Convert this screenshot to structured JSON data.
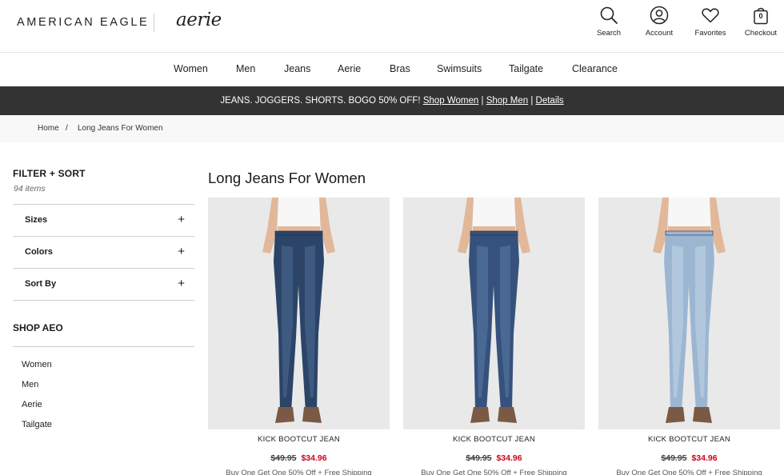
{
  "header": {
    "brand_primary": "AMERICAN EAGLE",
    "brand_secondary": "aerie",
    "utilities": {
      "search": "Search",
      "account": "Account",
      "favorites": "Favorites",
      "checkout": "Checkout",
      "bag_count": "0"
    }
  },
  "nav": {
    "categories": [
      "Women",
      "Men",
      "Jeans",
      "Aerie",
      "Bras",
      "Swimsuits",
      "Tailgate",
      "Clearance"
    ]
  },
  "promo": {
    "text": "JEANS. JOGGERS. SHORTS. BOGO 50% OFF!",
    "link_women": "Shop Women",
    "sep1": "|",
    "link_men": "Shop Men",
    "sep2": "|",
    "link_details": "Details"
  },
  "breadcrumb": {
    "home": "Home",
    "separator": "/",
    "current": "Long Jeans For Women"
  },
  "sidebar": {
    "filter_title": "FILTER + SORT",
    "item_count": "94 items",
    "facets": [
      {
        "label": "Sizes",
        "toggle": "+"
      },
      {
        "label": "Colors",
        "toggle": "+"
      },
      {
        "label": "Sort By",
        "toggle": "+"
      }
    ],
    "shop_title": "SHOP AEO",
    "shop_links": [
      "Women",
      "Men",
      "Aerie",
      "Tailgate"
    ]
  },
  "main": {
    "title": "Long Jeans For Women",
    "products": [
      {
        "name": "KICK BOOTCUT JEAN",
        "was": "$49.95",
        "now": "$34.96",
        "promo": "Buy One Get One 50% Off + Free Shipping",
        "wash": "#2b4468",
        "wash_light": "#4e6d96"
      },
      {
        "name": "KICK BOOTCUT JEAN",
        "was": "$49.95",
        "now": "$34.96",
        "promo": "Buy One Get One 50% Off + Free Shipping",
        "wash": "#36527c",
        "wash_light": "#5a7aa6"
      },
      {
        "name": "KICK BOOTCUT JEAN",
        "was": "$49.95",
        "now": "$34.96",
        "promo": "Buy One Get One 50% Off + Free Shipping",
        "wash": "#9cb6d2",
        "wash_light": "#c3d5e8"
      }
    ]
  },
  "colors": {
    "promo_bar": "#333333",
    "sale_price": "#d0021b",
    "breadcrumb_bg": "#f8f8f8"
  }
}
